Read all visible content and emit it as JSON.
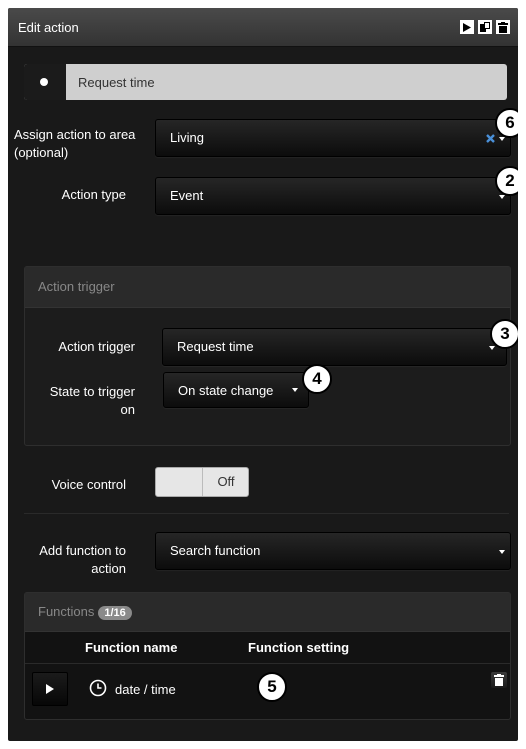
{
  "header": {
    "title": "Edit action",
    "buttons": [
      "play-icon",
      "copy-icon",
      "trash-icon"
    ]
  },
  "action_name": {
    "value": "Request time"
  },
  "area": {
    "label": "Assign action to area (optional)",
    "value": "Living",
    "clear_icon": "close-icon"
  },
  "action_type": {
    "label": "Action type",
    "value": "Event"
  },
  "trigger_section": {
    "title": "Action trigger",
    "trigger_label": "Action trigger",
    "trigger_value": "Request time",
    "state_label": "State to trigger on",
    "state_value": "On state change"
  },
  "voice": {
    "label": "Voice control",
    "state": "Off"
  },
  "add_function": {
    "label": "Add function to action",
    "value": "Search function"
  },
  "functions": {
    "title": "Functions",
    "count": "1/16",
    "columns": [
      "Function name",
      "Function setting"
    ],
    "rows": [
      {
        "name": "date / time",
        "icon": "clock-icon"
      }
    ]
  },
  "callouts": [
    "6",
    "2",
    "3",
    "4",
    "5"
  ]
}
